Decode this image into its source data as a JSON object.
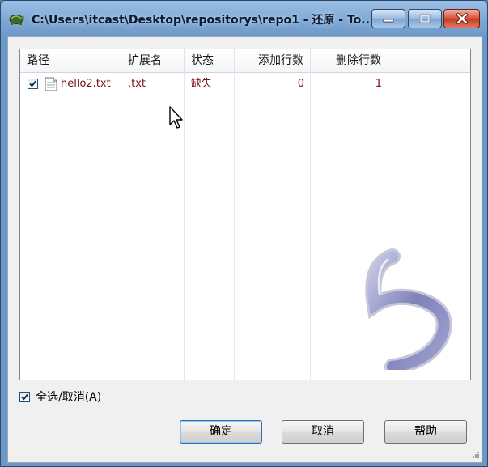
{
  "window": {
    "title": "C:\\Users\\itcast\\Desktop\\repositorys\\repo1 - 还原 - To..."
  },
  "list": {
    "columns": [
      "路径",
      "扩展名",
      "状态",
      "添加行数",
      "删除行数"
    ],
    "rows": [
      {
        "checked": true,
        "path": "hello2.txt",
        "ext": ".txt",
        "status": "缺失",
        "added": "0",
        "removed": "1"
      }
    ]
  },
  "select_all": {
    "checked": true,
    "label": "全选/取消(A)"
  },
  "buttons": {
    "ok": "确定",
    "cancel": "取消",
    "help": "帮助"
  },
  "colors": {
    "row_text": "#7a1010",
    "accent": "#2f6fb0"
  }
}
